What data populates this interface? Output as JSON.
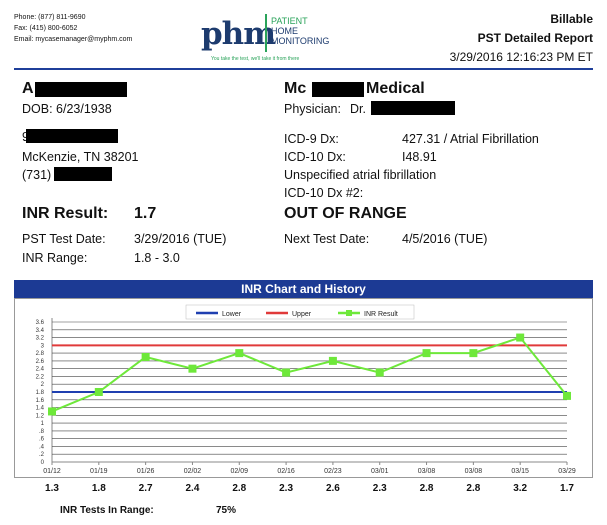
{
  "contact": {
    "phone": "Phone: (877) 811-9690",
    "fax": "Fax: (415) 800-6052",
    "email": "Email: mycasemanager@myphm.com"
  },
  "logo": {
    "mark": "phm",
    "line1": "PATIENT",
    "line2": "HOME",
    "line3": "MONITORING",
    "tagline": "You take the test, we'll take it from there",
    "mark_color": "#1d3b6e",
    "accent_color": "#2aa35a"
  },
  "report": {
    "status": "Billable",
    "title": "PST Detailed Report",
    "datetime": "3/29/2016 12:16:23 PM ET"
  },
  "patient": {
    "name_initial": "A",
    "dob": "DOB: 6/23/1938",
    "address_initial": "9",
    "city": "McKenzie, TN 38201",
    "phone_prefix": "(731)"
  },
  "practice": {
    "name_prefix": "Mc",
    "name_suffix": "Medical",
    "physician_label": "Physician:",
    "physician_prefix": "Dr."
  },
  "diagnosis": {
    "icd9_label": "ICD-9 Dx:",
    "icd9_value": "427.31 / Atrial Fibrillation",
    "icd10_label": "ICD-10 Dx:",
    "icd10_value": "I48.91",
    "icd10_desc": "Unspecified atrial fibrillation",
    "icd10_2_label": "ICD-10 Dx #2:"
  },
  "result": {
    "inr_label": "INR Result:",
    "inr_value": "1.7",
    "status": "OUT OF RANGE",
    "test_date_label": "PST Test Date:",
    "test_date_value": "3/29/2016 (TUE)",
    "next_date_label": "Next Test Date:",
    "next_date_value": "4/5/2016 (TUE)",
    "range_label": "INR Range:",
    "range_value": "1.8 - 3.0"
  },
  "chart_title": "INR Chart and History",
  "chart_data": {
    "type": "line",
    "categories": [
      "01/12",
      "01/19",
      "01/26",
      "02/02",
      "02/09",
      "02/16",
      "02/23",
      "03/01",
      "03/08",
      "03/08",
      "03/15",
      "03/29"
    ],
    "series": [
      {
        "name": "Lower",
        "values": [
          1.8,
          1.8,
          1.8,
          1.8,
          1.8,
          1.8,
          1.8,
          1.8,
          1.8,
          1.8,
          1.8,
          1.8
        ],
        "color": "#1f3fb0"
      },
      {
        "name": "Upper",
        "values": [
          3.0,
          3.0,
          3.0,
          3.0,
          3.0,
          3.0,
          3.0,
          3.0,
          3.0,
          3.0,
          3.0,
          3.0
        ],
        "color": "#e03a3a"
      },
      {
        "name": "INR Result",
        "values": [
          1.3,
          1.8,
          2.7,
          2.4,
          2.8,
          2.3,
          2.6,
          2.3,
          2.8,
          2.8,
          3.2,
          1.7
        ],
        "color": "#6ee83a"
      }
    ],
    "value_labels": [
      "1.3",
      "1.8",
      "2.7",
      "2.4",
      "2.8",
      "2.3",
      "2.6",
      "2.3",
      "2.8",
      "2.8",
      "3.2",
      "1.7"
    ],
    "yticks": [
      "0",
      ".2",
      ".4",
      ".6",
      ".8",
      "1",
      "1.2",
      "1.4",
      "1.6",
      "1.8",
      "2",
      "2.2",
      "2.4",
      "2.6",
      "2.8",
      "3",
      "3.2",
      "3.4",
      "3.6"
    ],
    "ylim": [
      0,
      3.6
    ],
    "grid": true,
    "legend": "top-center"
  },
  "summary": {
    "label": "INR Tests In Range:",
    "value": "75%"
  }
}
